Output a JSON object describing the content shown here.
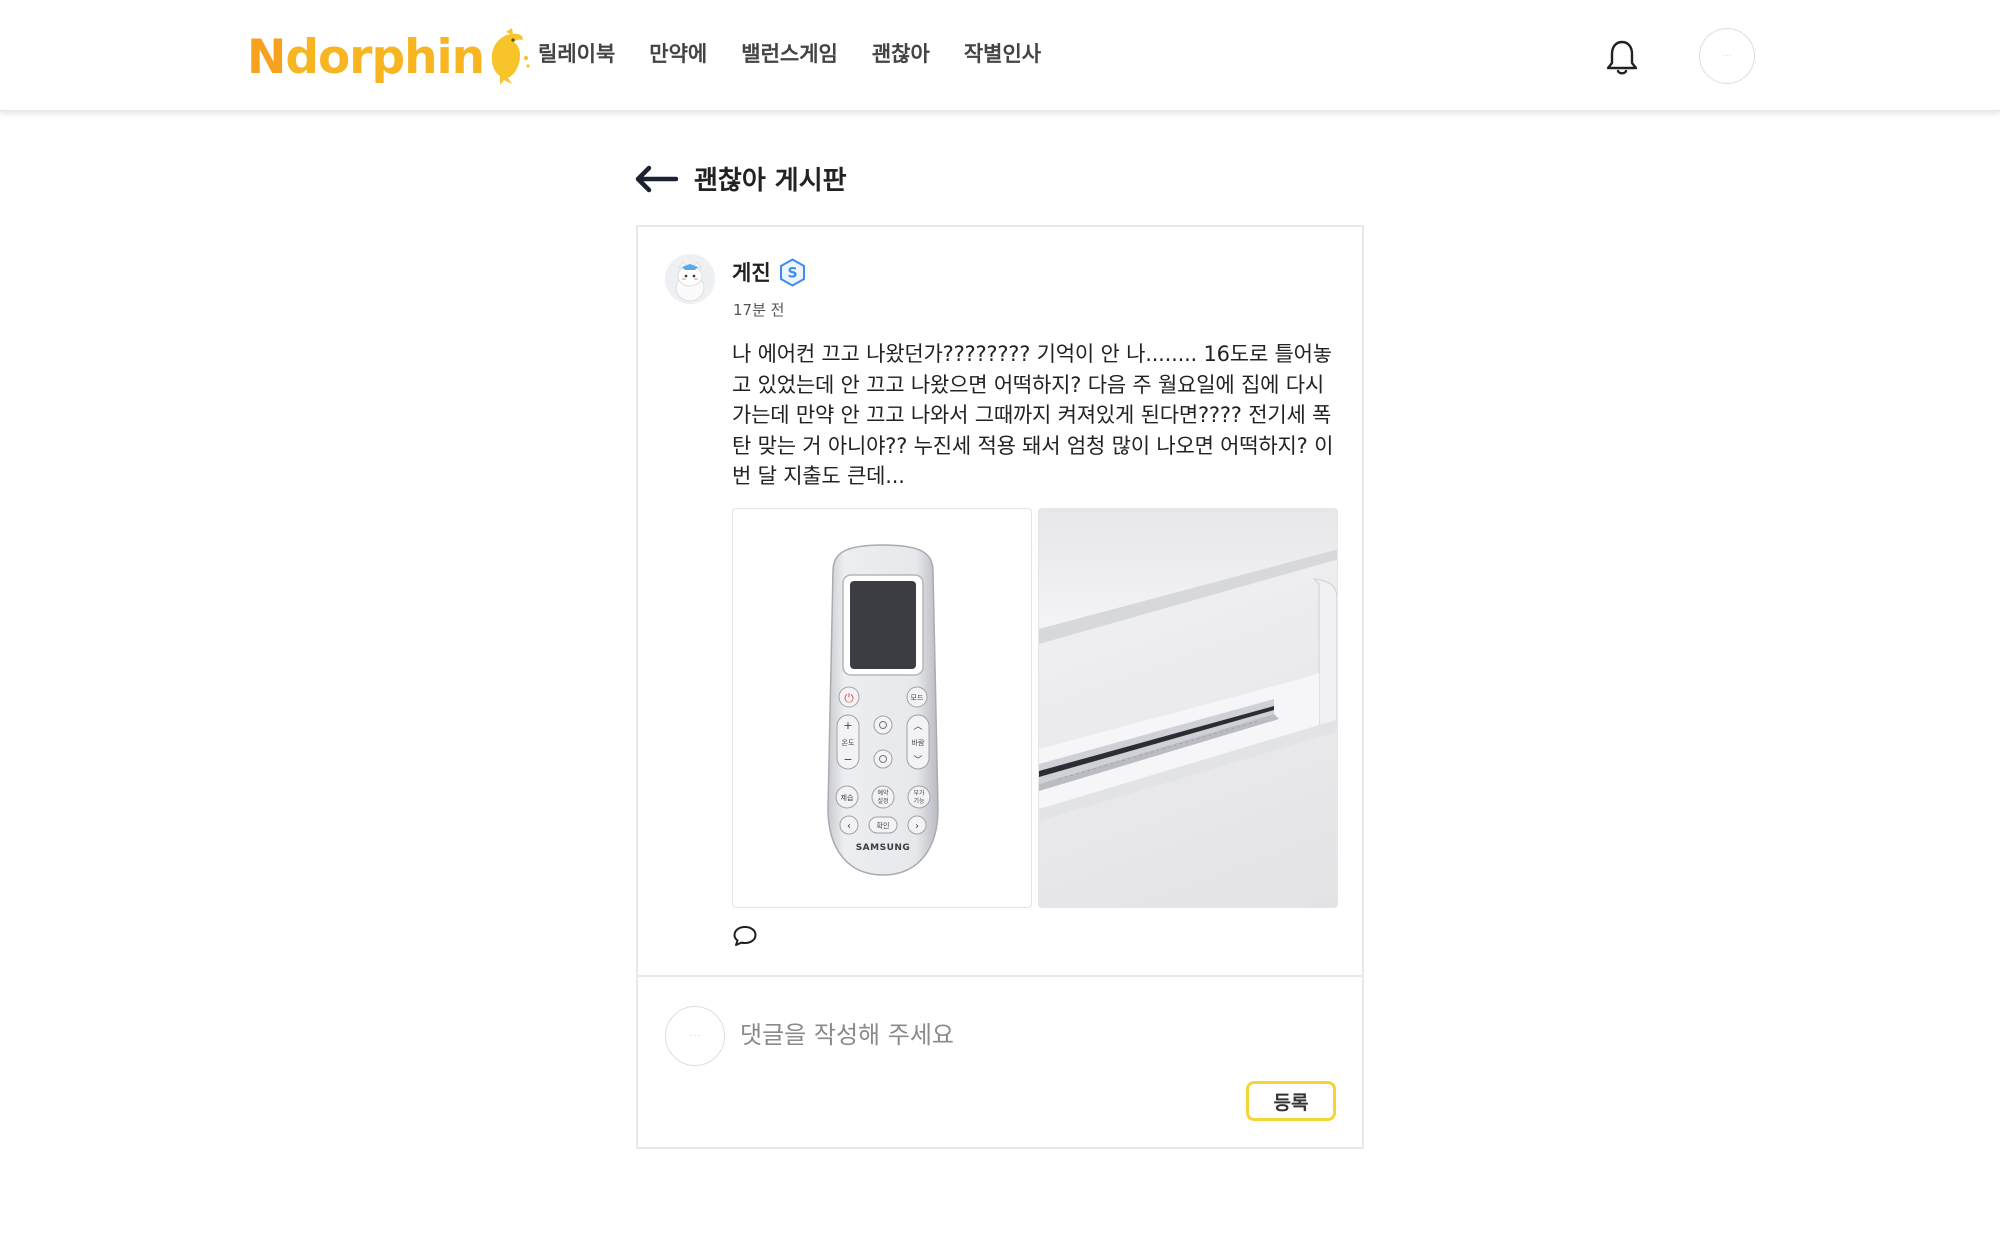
{
  "header": {
    "logo_text_first": "N",
    "logo_text_rest": "dorphin",
    "nav": [
      "릴레이북",
      "만약에",
      "밸런스게임",
      "괜찮아",
      "작별인사"
    ],
    "profile_avatar_text": "· · ·"
  },
  "board": {
    "title": "괜찮아 게시판"
  },
  "post": {
    "author": "게진",
    "badge": "S",
    "time": "17분 전",
    "body": "나 에어컨 끄고 나왔던가???????? 기억이 안 나........ 16도로 틀어놓고 있었는데 안 끄고 나왔으면 어떡하지? 다음 주 월요일에 집에 다시 가는데 만약 안 끄고 나와서 그때까지 켜져있게 된다면???? 전기세 폭탄 맞는 거 아니야?? 누진세 적용 돼서 엄청 많이 나오면 어떡하지? 이번 달 지출도 큰데..."
  },
  "remote": {
    "brand": "SAMSUNG",
    "btn_mode": "모드",
    "btn_temp": "온도",
    "btn_wind": "바람",
    "btn_dehum": "제습",
    "btn_reserve": "예약",
    "btn_reserve2": "설정",
    "btn_extra": "부가",
    "btn_extra2": "기능",
    "btn_confirm": "확인"
  },
  "comment_form": {
    "avatar_text": "· · ·",
    "placeholder": "댓글을 작성해 주세요",
    "submit_label": "등록"
  },
  "colors": {
    "logo_orange": "#f6a21e",
    "logo_yellow": "#f7b522",
    "badge_blue": "#3d8bf2",
    "button_border": "#f5d43a"
  }
}
